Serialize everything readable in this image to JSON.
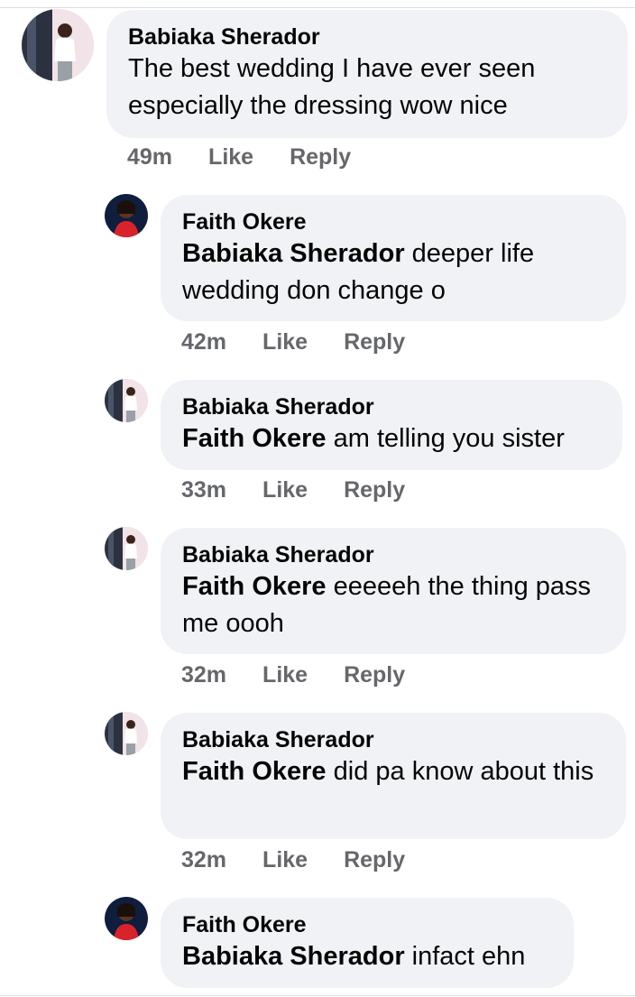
{
  "comments": [
    {
      "author": "Babiaka Sherador",
      "tag": "",
      "text": "The best wedding I have ever seen especially the dressing wow nice",
      "time": "49m",
      "like": "Like",
      "reply": "Reply",
      "avatar_icon": "profile-photo-woman-white-top"
    },
    {
      "author": "Faith Okere",
      "tag": "Babiaka Sherador",
      "text": "deeper life wedding don change o",
      "time": "42m",
      "like": "Like",
      "reply": "Reply",
      "avatar_icon": "profile-photo-woman-red-top"
    },
    {
      "author": "Babiaka Sherador",
      "tag": "Faith Okere",
      "text": "am telling you sister",
      "time": "33m",
      "like": "Like",
      "reply": "Reply",
      "avatar_icon": "profile-photo-woman-white-top"
    },
    {
      "author": "Babiaka Sherador",
      "tag": "Faith Okere",
      "text": "eeeeeh the thing pass me oooh",
      "time": "32m",
      "like": "Like",
      "reply": "Reply",
      "avatar_icon": "profile-photo-woman-white-top"
    },
    {
      "author": "Babiaka Sherador",
      "tag": "Faith Okere",
      "text": "did pa know about this",
      "time": "32m",
      "like": "Like",
      "reply": "Reply",
      "avatar_icon": "profile-photo-woman-white-top"
    },
    {
      "author": "Faith Okere",
      "tag": "Babiaka Sherador",
      "text": "infact ehn",
      "avatar_icon": "profile-photo-woman-red-top"
    }
  ],
  "colors": {
    "bubble": "#f0f2f5",
    "text": "#050505",
    "meta": "#65676b",
    "divider": "#dcdde1"
  }
}
